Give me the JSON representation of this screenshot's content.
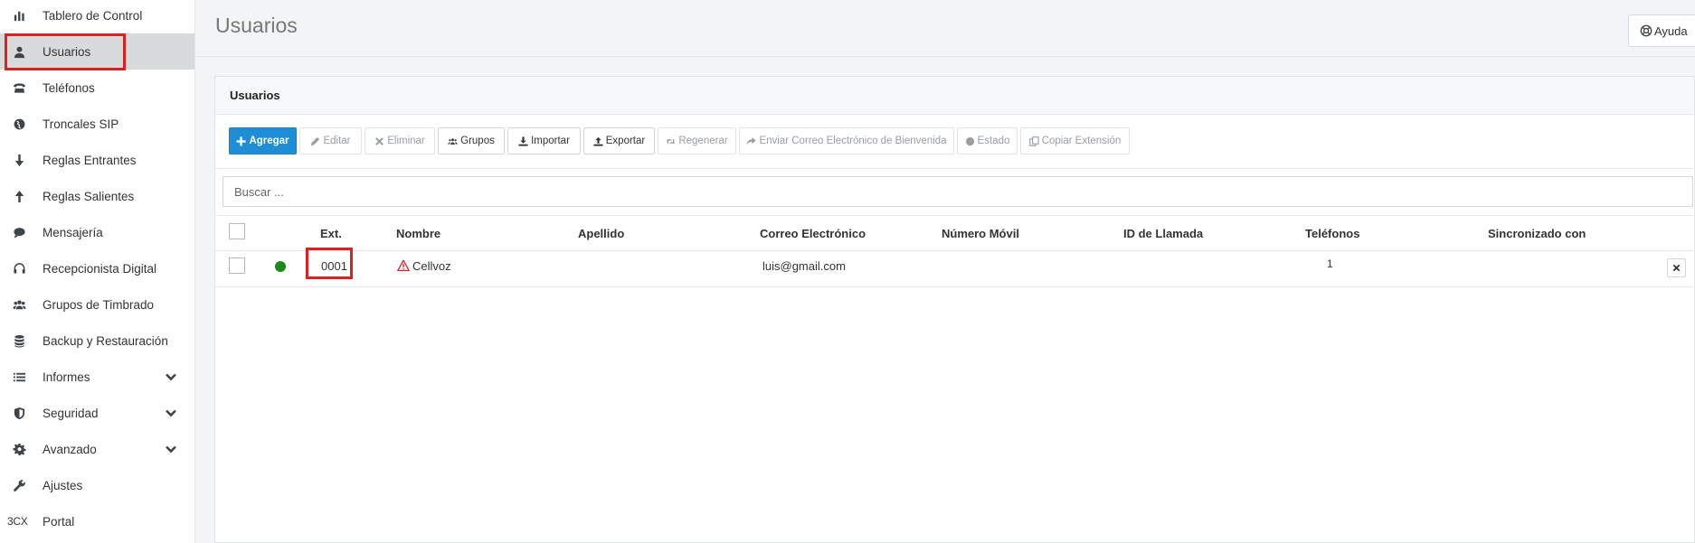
{
  "sidebar": {
    "items": [
      {
        "label": "Tablero de Control",
        "icon": "bar-chart-icon"
      },
      {
        "label": "Usuarios",
        "icon": "user-icon"
      },
      {
        "label": "Teléfonos",
        "icon": "phone-icon"
      },
      {
        "label": "Troncales SIP",
        "icon": "globe-icon"
      },
      {
        "label": "Reglas Entrantes",
        "icon": "arrow-down-icon"
      },
      {
        "label": "Reglas Salientes",
        "icon": "arrow-up-icon"
      },
      {
        "label": "Mensajería",
        "icon": "chat-icon"
      },
      {
        "label": "Recepcionista Digital",
        "icon": "headset-icon"
      },
      {
        "label": "Grupos de Timbrado",
        "icon": "group-icon"
      },
      {
        "label": "Backup y Restauración",
        "icon": "database-icon"
      },
      {
        "label": "Informes",
        "icon": "list-icon"
      },
      {
        "label": "Seguridad",
        "icon": "shield-icon"
      },
      {
        "label": "Avanzado",
        "icon": "gear-icon"
      },
      {
        "label": "Ajustes",
        "icon": "wrench-icon"
      },
      {
        "label": "Portal",
        "icon_text": "3CX"
      }
    ]
  },
  "header": {
    "title": "Usuarios",
    "help_label": "Ayuda"
  },
  "panel": {
    "title": "Usuarios"
  },
  "toolbar": {
    "add": "Agregar",
    "edit": "Editar",
    "delete": "Eliminar",
    "groups": "Grupos",
    "import": "Importar",
    "export": "Exportar",
    "regenerate": "Regenerar",
    "send_welcome": "Enviar Correo Electrónico de Bienvenida",
    "status": "Estado",
    "copy_extension": "Copiar Extensión"
  },
  "search": {
    "placeholder": "Buscar ..."
  },
  "table": {
    "columns": {
      "ext": "Ext.",
      "first_name": "Nombre",
      "last_name": "Apellido",
      "email": "Correo Electrónico",
      "mobile": "Número Móvil",
      "caller_id": "ID de Llamada",
      "phones": "Teléfonos",
      "synced_with": "Sincronizado con"
    },
    "rows": [
      {
        "status_color": "#1a8a1a",
        "ext": "0001",
        "first_name": "Cellvoz",
        "last_name": "",
        "email": "luis@gmail.com",
        "mobile": "",
        "caller_id": "",
        "phones": "1",
        "synced_with": ""
      }
    ]
  },
  "colors": {
    "primary": "#1e8fd6",
    "highlight": "#e02020",
    "status_online": "#1a8a1a",
    "warning": "#d9262c"
  }
}
